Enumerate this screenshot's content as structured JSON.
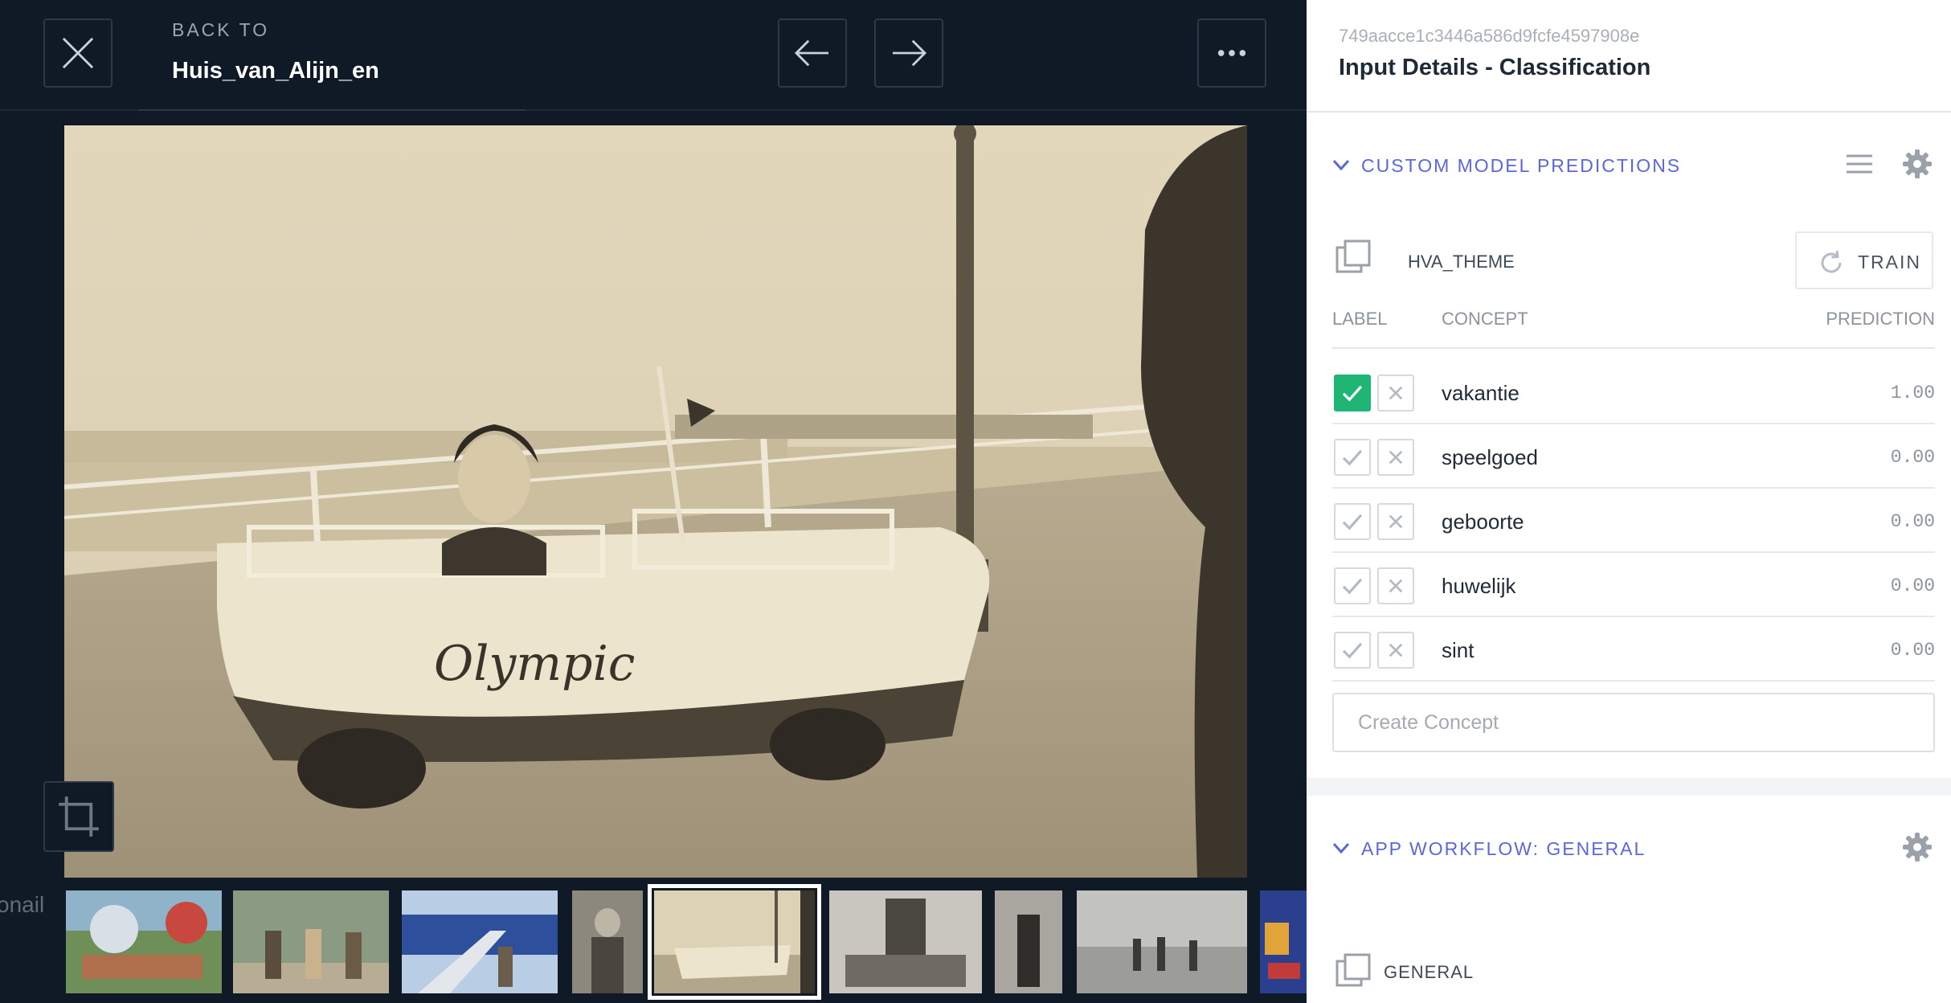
{
  "header": {
    "back_to_label": "BACK TO",
    "back_to_name": "Huis_van_Alijn_en"
  },
  "thumbnails": {
    "side_text": "onail",
    "items": [
      "photo-beach-umbrellas",
      "photo-group-palms",
      "photo-airplane-stairs",
      "photo-uniform-man",
      "photo-olympic-boat-car",
      "photo-kiosk-crowd",
      "photo-bathers",
      "photo-beach-kids",
      "photo-poster"
    ]
  },
  "panel": {
    "input_id": "749aacce1c3446a586d9fcfe4597908e",
    "title": "Input Details - Classification",
    "custom_section": {
      "title": "CUSTOM MODEL PREDICTIONS",
      "model_name": "HVA_THEME",
      "train_label": "TRAIN",
      "columns": {
        "label": "LABEL",
        "concept": "CONCEPT",
        "prediction": "PREDICTION"
      },
      "rows": [
        {
          "concept": "vakantie",
          "prediction": "1.00",
          "checked": true
        },
        {
          "concept": "speelgoed",
          "prediction": "0.00",
          "checked": false
        },
        {
          "concept": "geboorte",
          "prediction": "0.00",
          "checked": false
        },
        {
          "concept": "huwelijk",
          "prediction": "0.00",
          "checked": false
        },
        {
          "concept": "sint",
          "prediction": "0.00",
          "checked": false
        }
      ],
      "create_placeholder": "Create Concept"
    },
    "workflow_section": {
      "title": "APP WORKFLOW: GENERAL",
      "model_name": "GENERAL"
    }
  },
  "colors": {
    "viewer_bg": "#0f1a26",
    "accent": "#5b67dc",
    "checked_green": "#1fb574"
  }
}
